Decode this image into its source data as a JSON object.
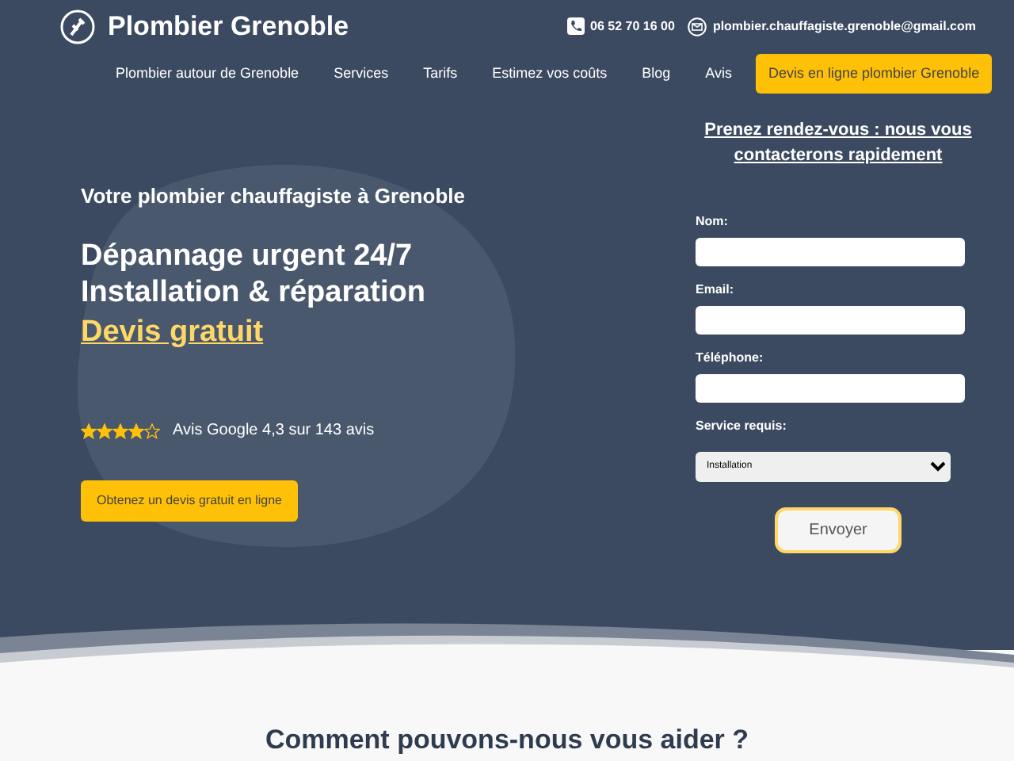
{
  "header": {
    "title": "Plombier Grenoble",
    "phone": "06 52 70 16 00",
    "email": "plombier.chauffagiste.grenoble@gmail.com"
  },
  "nav": [
    {
      "label": "Plombier autour de Grenoble",
      "kind": "link"
    },
    {
      "label": "Services",
      "kind": "link"
    },
    {
      "label": "Tarifs",
      "kind": "link"
    },
    {
      "label": "Estimez vos coûts",
      "kind": "link"
    },
    {
      "label": "Blog",
      "kind": "link"
    },
    {
      "label": "Avis",
      "kind": "link"
    },
    {
      "label": "Devis en ligne plombier Grenoble",
      "kind": "button"
    }
  ],
  "hero": {
    "subtitle": "Votre plombier chauffagiste à Grenoble",
    "headline": [
      "Dépannage urgent 24/7",
      "Installation & réparation"
    ],
    "highlight": "Devis gratuit",
    "stars": 4,
    "rating": "Avis Google 4,3 sur 143 avis",
    "cta": "Obtenez un devis gratuit en ligne"
  },
  "form": {
    "title": "Prenez rendez-vous : nous vous contacterons rapidement",
    "fields": [
      {
        "label": "Nom:",
        "kind": "text"
      },
      {
        "label": "Email:",
        "kind": "text"
      },
      {
        "label": "Téléphone:",
        "kind": "text"
      },
      {
        "label": "Service requis:",
        "kind": "select",
        "value": "Installation"
      }
    ],
    "submit": "Envoyer"
  },
  "section": {
    "title": "Comment pouvons-nous vous aider ?"
  }
}
